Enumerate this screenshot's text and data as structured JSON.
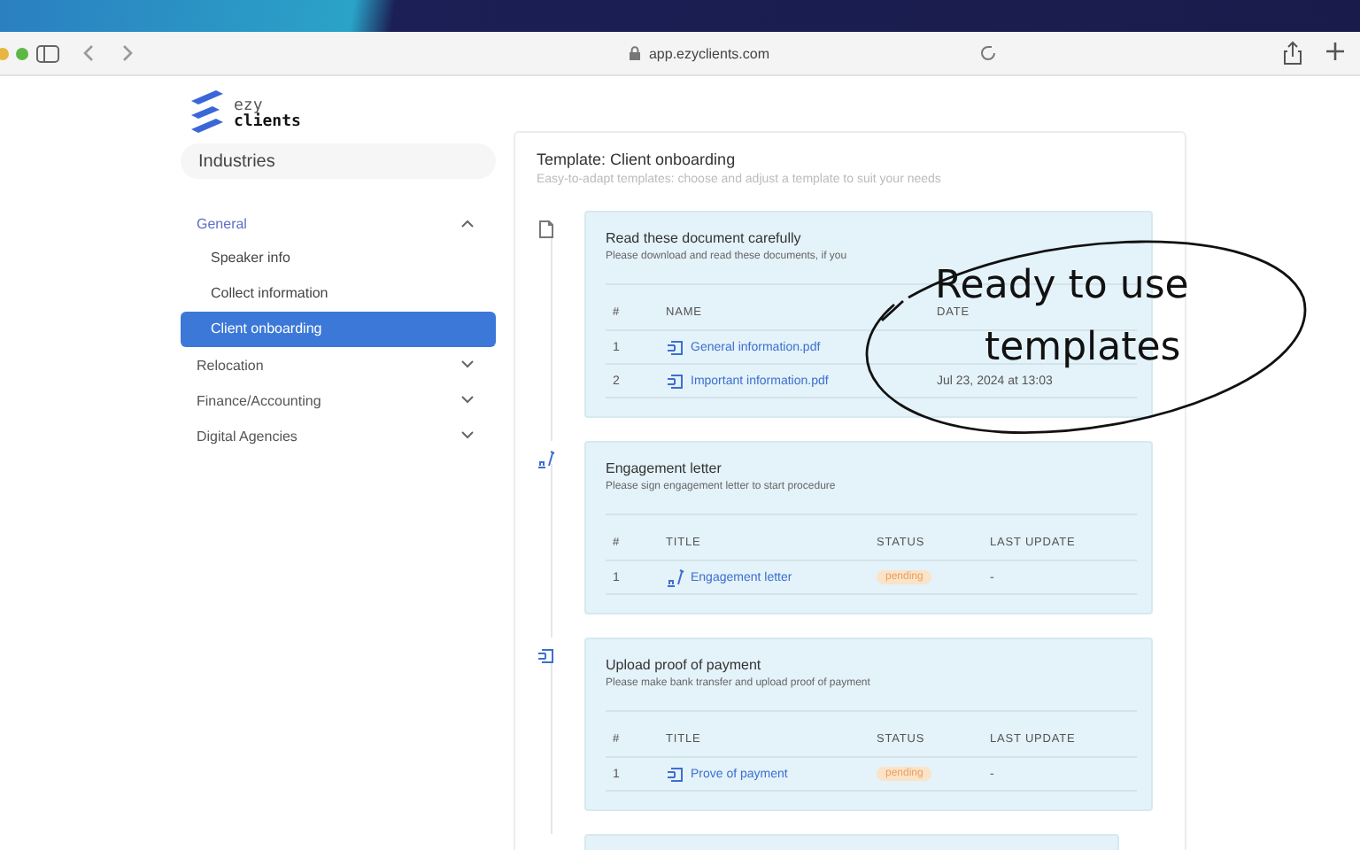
{
  "browser": {
    "url": "app.ezyclients.com"
  },
  "logo": {
    "line_1": "ezy",
    "line_2": "clients"
  },
  "sidebar": {
    "title": "Industries",
    "items": [
      {
        "label": "General",
        "expanded": true,
        "children": [
          {
            "label": "Speaker info",
            "selected": false
          },
          {
            "label": "Collect information",
            "selected": false
          },
          {
            "label": "Client onboarding",
            "selected": true
          }
        ]
      },
      {
        "label": "Relocation",
        "expanded": false
      },
      {
        "label": "Finance/Accounting",
        "expanded": false
      },
      {
        "label": "Digital Agencies",
        "expanded": false
      }
    ]
  },
  "template": {
    "title": "Template: Client onboarding",
    "subtitle": "Easy-to-adapt templates: choose and adjust a template to suit your needs",
    "steps": [
      {
        "kind": "document",
        "title": "Read these document carefully",
        "description": "Please download and read these documents, if you",
        "columns": [
          "#",
          "NAME",
          "DATE"
        ],
        "rows": [
          {
            "number": "1",
            "name": "General information.pdf"
          },
          {
            "number": "2",
            "name": "Important information.pdf",
            "date": "Jul 23, 2024 at 13:03"
          }
        ]
      },
      {
        "kind": "signature",
        "title": "Engagement letter",
        "description": "Please sign engagement letter to start procedure",
        "columns": [
          "#",
          "TITLE",
          "STATUS",
          "LAST UPDATE"
        ],
        "rows": [
          {
            "number": "1",
            "name": "Engagement letter",
            "status": "pending",
            "last_update": "-"
          }
        ]
      },
      {
        "kind": "payment",
        "title": "Upload proof of payment",
        "description": "Please make bank transfer and upload proof of payment",
        "columns": [
          "#",
          "TITLE",
          "STATUS",
          "LAST UPDATE"
        ],
        "rows": [
          {
            "number": "1",
            "name": "Prove of payment",
            "status": "pending",
            "last_update": "-"
          }
        ]
      },
      {
        "kind": "stub"
      }
    ]
  },
  "callout": {
    "line_1": "Ready to use",
    "line_2": "templates"
  }
}
